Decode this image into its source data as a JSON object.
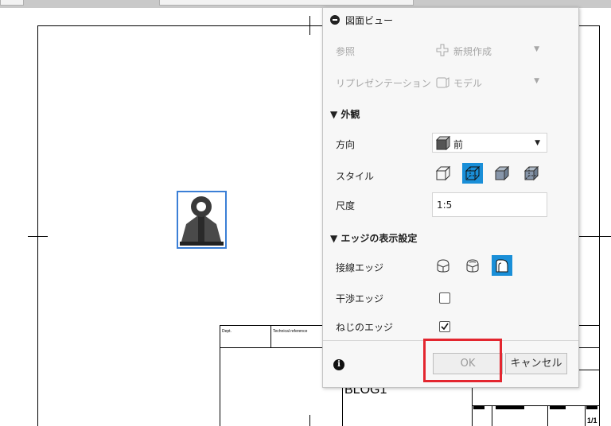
{
  "dialog": {
    "title": "図面ビュー",
    "reference": {
      "label": "参照",
      "value": "新規作成"
    },
    "representation": {
      "label": "リプレゼンテーション",
      "value": "モデル"
    },
    "appearance": {
      "section_label": "▼ 外観",
      "orientation": {
        "label": "方向",
        "value": "前"
      },
      "style": {
        "label": "スタイル"
      },
      "scale": {
        "label": "尺度",
        "value": "1:5"
      }
    },
    "edge_settings": {
      "section_label": "▼ エッジの表示設定",
      "tangent_edges": {
        "label": "接線エッジ"
      },
      "interference_edges": {
        "label": "干渉エッジ",
        "checked": false
      },
      "thread_edges": {
        "label": "ねじのエッジ",
        "checked": true
      }
    },
    "ok_label": "OK",
    "cancel_label": "キャンセル",
    "info_glyph": "i"
  },
  "title_block": {
    "dept_label": "Dept.",
    "tech_ref_label": "Technical reference",
    "drawing_title": "BLOG1",
    "sheet": "1/1"
  },
  "colors": {
    "accent": "#1a8fd8",
    "highlight": "#e3262f",
    "selection_border": "#3b7fd6"
  }
}
